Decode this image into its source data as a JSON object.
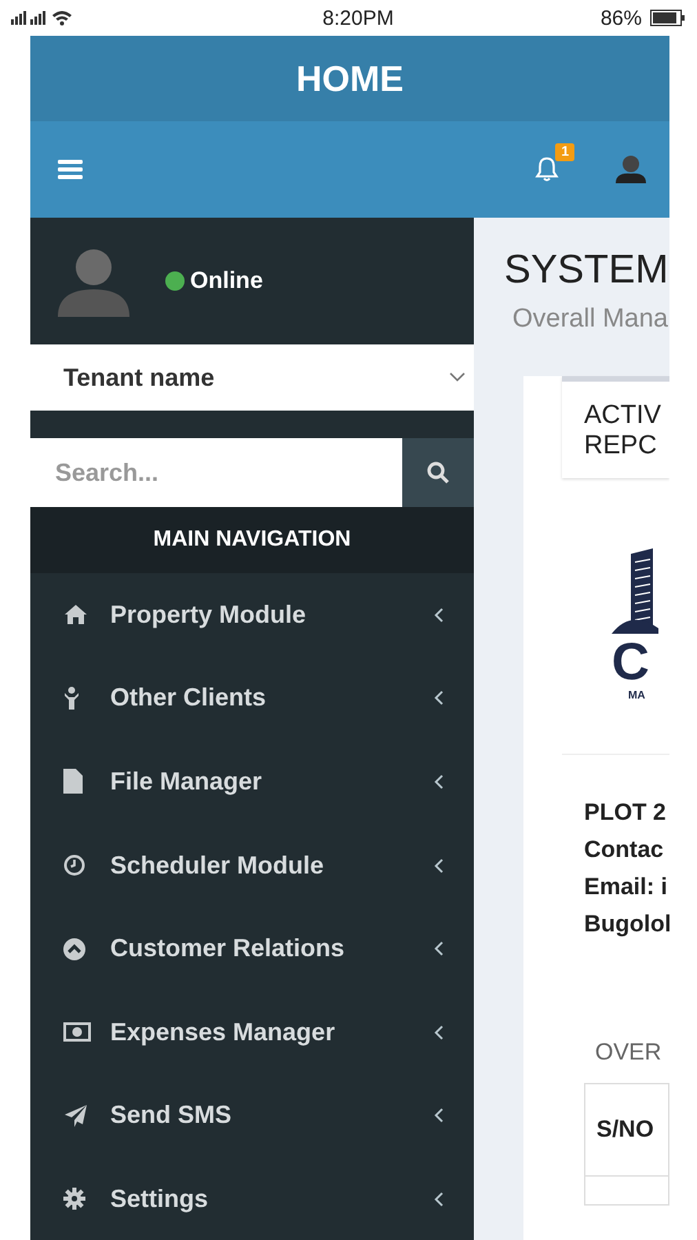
{
  "status_bar": {
    "time": "8:20PM",
    "battery": "86%"
  },
  "header": {
    "title": "HOME",
    "notification_count": "1"
  },
  "user_panel": {
    "status": "Online",
    "online": true
  },
  "tenant_select": {
    "value": "Tenant name"
  },
  "search": {
    "placeholder": "Search..."
  },
  "nav_header": "MAIN NAVIGATION",
  "nav_items": [
    {
      "label": "Property Module"
    },
    {
      "label": "Other Clients"
    },
    {
      "label": "File Manager"
    },
    {
      "label": "Scheduler Module"
    },
    {
      "label": "Customer Relations"
    },
    {
      "label": "Expenses Manager"
    },
    {
      "label": "Send SMS"
    },
    {
      "label": "Settings"
    }
  ],
  "content": {
    "title": "SYSTEM",
    "subtitle": "Overall Mana",
    "card_title": [
      "ACTIV",
      "REPC"
    ],
    "logo_text": "C",
    "logo_subtext": "MA",
    "address_lines": [
      "PLOT 2",
      "Contac",
      "Email: i",
      "Bugolol"
    ],
    "section_title": "OVER",
    "table_columns": [
      "S/NO"
    ]
  }
}
